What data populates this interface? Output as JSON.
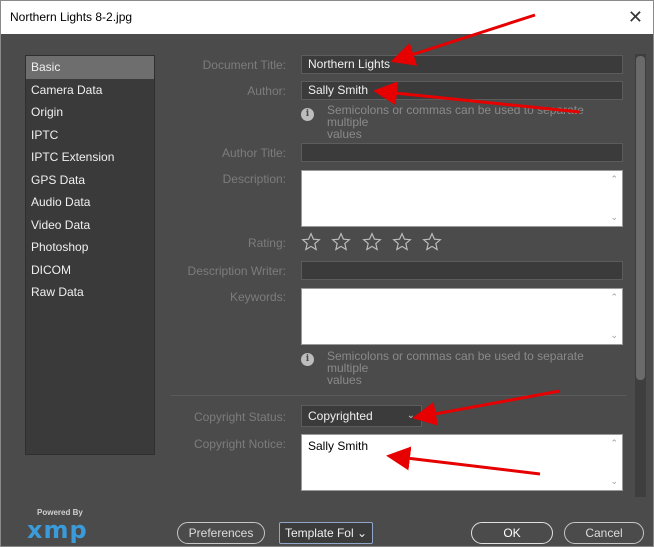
{
  "window": {
    "title": "Northern Lights 8-2.jpg",
    "close_glyph": "✕"
  },
  "sidebar": {
    "items": [
      {
        "label": "Basic"
      },
      {
        "label": "Camera Data"
      },
      {
        "label": "Origin"
      },
      {
        "label": "IPTC"
      },
      {
        "label": "IPTC Extension"
      },
      {
        "label": "GPS Data"
      },
      {
        "label": "Audio Data"
      },
      {
        "label": "Video Data"
      },
      {
        "label": "Photoshop"
      },
      {
        "label": "DICOM"
      },
      {
        "label": "Raw Data"
      }
    ],
    "selected": "Basic"
  },
  "branding": {
    "powered_by": "Powered By",
    "logo_text": "xmp"
  },
  "form": {
    "document_title": {
      "label": "Document Title:",
      "value": "Northern Lights"
    },
    "author": {
      "label": "Author:",
      "value": "Sally Smith"
    },
    "author_hint": {
      "line1": "Semicolons or commas can be used to separate multiple",
      "line2": "values"
    },
    "author_title": {
      "label": "Author Title:",
      "value": ""
    },
    "description": {
      "label": "Description:",
      "value": ""
    },
    "rating": {
      "label": "Rating:",
      "stars": 5,
      "value": 0
    },
    "description_writer": {
      "label": "Description Writer:",
      "value": ""
    },
    "keywords": {
      "label": "Keywords:",
      "value": ""
    },
    "keywords_hint": {
      "line1": "Semicolons or commas can be used to separate multiple",
      "line2": "values"
    },
    "copyright_status": {
      "label": "Copyright Status:",
      "value": "Copyrighted"
    },
    "copyright_notice": {
      "label": "Copyright Notice:",
      "value": "Sally Smith"
    }
  },
  "buttons": {
    "preferences": "Preferences",
    "template_folder": "Template Fol",
    "ok": "OK",
    "cancel": "Cancel"
  },
  "icons": {
    "info": "info-icon",
    "star": "star-outline-icon",
    "chevron": "chevron-down-icon",
    "scroll_up": "scroll-up-icon",
    "scroll_down": "scroll-down-icon",
    "annotation": "red-arrow-icon"
  },
  "colors": {
    "dialog_bg": "#4b4b4b",
    "sidebar_bg": "#3a3a3a",
    "selected_item": "#6e6e6e",
    "annotation_arrow": "#e60000",
    "xmp_logo": "#3b9ad9"
  }
}
